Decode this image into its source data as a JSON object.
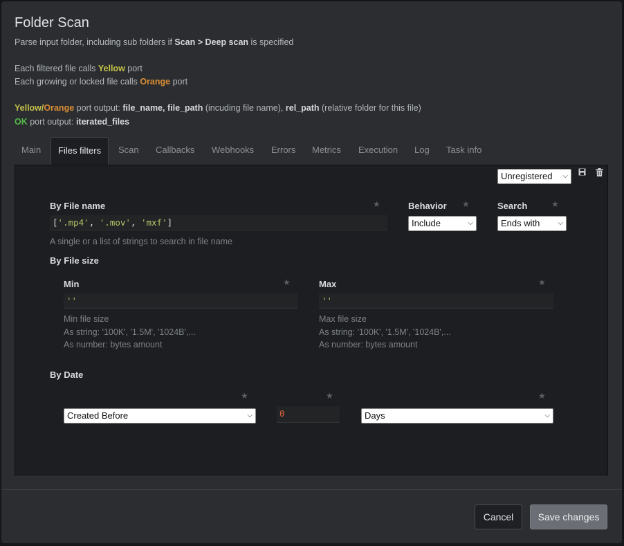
{
  "modal": {
    "title": "Folder Scan",
    "desc1_prefix": "Parse input folder, including sub folders if ",
    "desc1_bold": "Scan > Deep scan",
    "desc1_suffix": " is specified",
    "desc2_prefix": "Each filtered file calls ",
    "desc2_color": "Yellow",
    "desc2_suffix": " port",
    "desc3_prefix": "Each growing or locked file calls ",
    "desc3_color": "Orange",
    "desc3_suffix": " port",
    "desc4_yellow": "Yellow",
    "desc4_slash": "/",
    "desc4_orange": "Orange",
    "desc4_text1": " port output: ",
    "desc4_bold1": "file_name, file_path",
    "desc4_text2": " (incuding file name), ",
    "desc4_bold2": "rel_path",
    "desc4_text3": " (relative folder for this file)",
    "desc5_ok": "OK",
    "desc5_text": " port output: ",
    "desc5_bold": "iterated_files"
  },
  "tabs": [
    "Main",
    "Files filters",
    "Scan",
    "Callbacks",
    "Webhooks",
    "Errors",
    "Metrics",
    "Execution",
    "Log",
    "Task info"
  ],
  "active_tab": "Files filters",
  "panel": {
    "registration_select": "Unregistered",
    "save_icon": "floppy-disk-icon",
    "delete_icon": "trash-icon",
    "by_file_name": {
      "label": "By File name",
      "value_open": "[",
      "value_items": [
        "'.mp4'",
        "'.mov'",
        "'mxf'"
      ],
      "value_sep": ", ",
      "value_close": "]",
      "help": "A single or a list of strings to search in file name"
    },
    "behavior": {
      "label": "Behavior",
      "value": "Include"
    },
    "search": {
      "label": "Search",
      "value": "Ends with"
    },
    "by_file_size": {
      "label": "By File size",
      "min": {
        "label": "Min",
        "value": "''",
        "help1": "Min file size",
        "help2": "As string: '100K', '1.5M', '1024B',...",
        "help3": "As number: bytes amount"
      },
      "max": {
        "label": "Max",
        "value": "''",
        "help1": "Max file size",
        "help2": "As string: '100K', '1.5M', '1024B',...",
        "help3": "As number: bytes amount"
      }
    },
    "by_date": {
      "label": "By Date",
      "mode": "Created Before",
      "amount": "0",
      "unit": "Days"
    }
  },
  "footer": {
    "cancel": "Cancel",
    "save": "Save changes"
  },
  "colors": {
    "yellow": "#c4c14a",
    "orange": "#d98d35",
    "green": "#55b949",
    "star": "#5b5f64"
  }
}
